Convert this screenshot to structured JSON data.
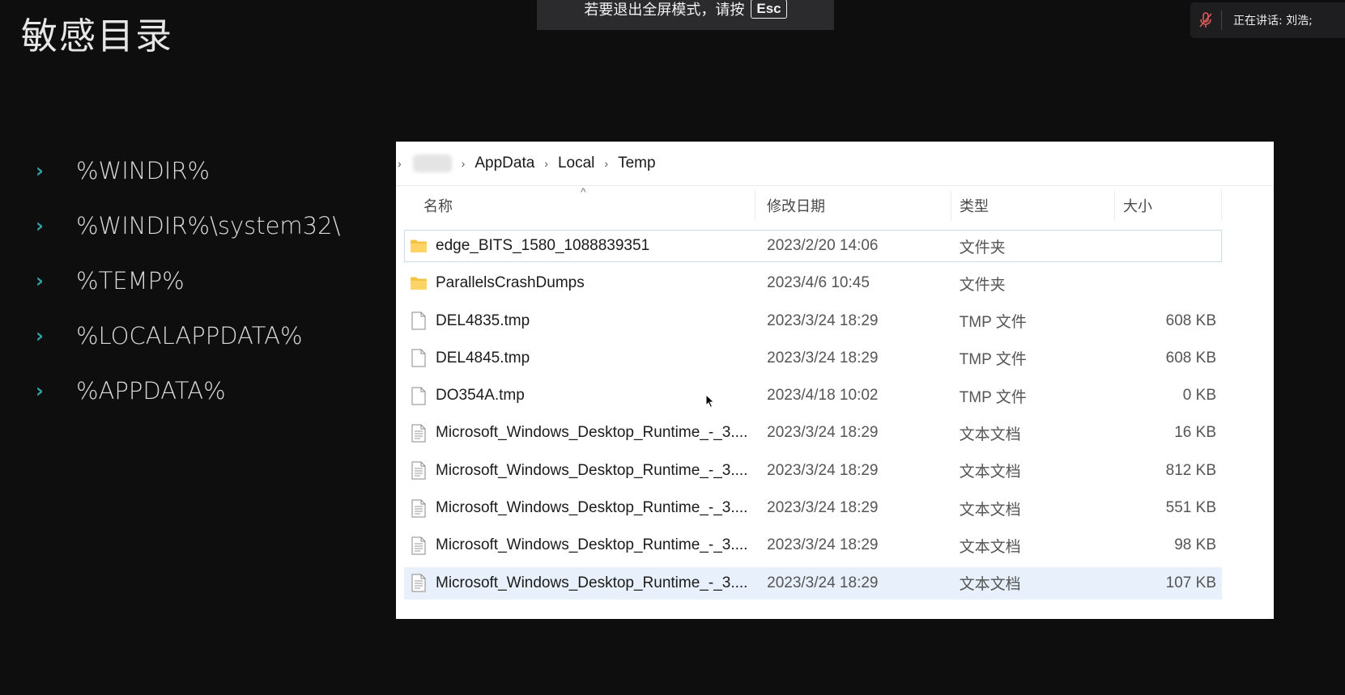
{
  "slide": {
    "title": "敏感目录",
    "bullets": [
      "%WINDIR%",
      "%WINDIR%\\system32\\",
      "%TEMP%",
      "%LOCALAPPDATA%",
      "%APPDATA%"
    ]
  },
  "fullscreen_banner": {
    "text": "若要退出全屏模式，请按",
    "key": "Esc"
  },
  "speaker": {
    "text": "正在讲话: 刘浩;",
    "icon": "mic-muted-icon"
  },
  "explorer": {
    "breadcrumb": [
      "AppData",
      "Local",
      "Temp"
    ],
    "columns": {
      "name": "名称",
      "date": "修改日期",
      "type": "类型",
      "size": "大小"
    },
    "files": [
      {
        "icon": "folder-icon",
        "name": "edge_BITS_1580_1088839351",
        "date": "2023/2/20 14:06",
        "type": "文件夹",
        "size": ""
      },
      {
        "icon": "folder-icon",
        "name": "ParallelsCrashDumps",
        "date": "2023/4/6 10:45",
        "type": "文件夹",
        "size": ""
      },
      {
        "icon": "file-icon",
        "name": "DEL4835.tmp",
        "date": "2023/3/24 18:29",
        "type": "TMP 文件",
        "size": "608 KB"
      },
      {
        "icon": "file-icon",
        "name": "DEL4845.tmp",
        "date": "2023/3/24 18:29",
        "type": "TMP 文件",
        "size": "608 KB"
      },
      {
        "icon": "file-icon",
        "name": "DO354A.tmp",
        "date": "2023/4/18 10:02",
        "type": "TMP 文件",
        "size": "0 KB"
      },
      {
        "icon": "text-file-icon",
        "name": "Microsoft_Windows_Desktop_Runtime_-_3....",
        "date": "2023/3/24 18:29",
        "type": "文本文档",
        "size": "16 KB"
      },
      {
        "icon": "text-file-icon",
        "name": "Microsoft_Windows_Desktop_Runtime_-_3....",
        "date": "2023/3/24 18:29",
        "type": "文本文档",
        "size": "812 KB"
      },
      {
        "icon": "text-file-icon",
        "name": "Microsoft_Windows_Desktop_Runtime_-_3....",
        "date": "2023/3/24 18:29",
        "type": "文本文档",
        "size": "551 KB"
      },
      {
        "icon": "text-file-icon",
        "name": "Microsoft_Windows_Desktop_Runtime_-_3....",
        "date": "2023/3/24 18:29",
        "type": "文本文档",
        "size": "98 KB"
      },
      {
        "icon": "text-file-icon",
        "name": "Microsoft_Windows_Desktop_Runtime_-_3....",
        "date": "2023/3/24 18:29",
        "type": "文本文档",
        "size": "107 KB"
      }
    ]
  },
  "colors": {
    "accent": "#2fa3a9",
    "selection": "#e7f0fb",
    "background": "#0e0e0f",
    "folder": "#f5c242"
  }
}
